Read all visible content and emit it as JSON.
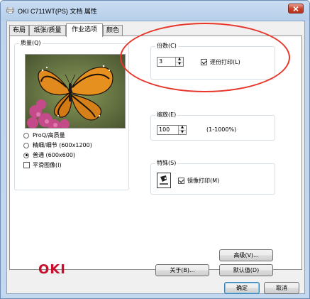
{
  "window": {
    "title": "OKI C711WT(PS) 文档 属性"
  },
  "tabs": [
    {
      "label": "布局"
    },
    {
      "label": "纸张/质量"
    },
    {
      "label": "作业选项"
    },
    {
      "label": "颜色"
    }
  ],
  "quality": {
    "title": "质量(Q)",
    "options": [
      {
        "label": "ProQ/高质量",
        "selected": false
      },
      {
        "label": "精细/细节 (600x1200)",
        "selected": false
      },
      {
        "label": "普通 (600x600)",
        "selected": true
      }
    ],
    "smooth_label": "平滑图像(I)",
    "smooth_checked": false
  },
  "copies": {
    "title": "份数(C)",
    "value": "3",
    "collate_label": "逐份打印(L)",
    "collate_checked": true
  },
  "scale": {
    "title": "缩放(E)",
    "value": "100",
    "range": "(1-1000%)"
  },
  "special": {
    "title": "特殊(S)",
    "mirror_label": "镜像打印(M)",
    "mirror_checked": true
  },
  "buttons": {
    "advanced": "高级(V)...",
    "about": "关于(B)...",
    "defaults": "默认值(D)",
    "ok": "确定",
    "cancel": "取消"
  },
  "brand": {
    "logo": "OKI",
    "logo_color": "#c8102e"
  },
  "annotation": {
    "color": "#e8352a"
  }
}
